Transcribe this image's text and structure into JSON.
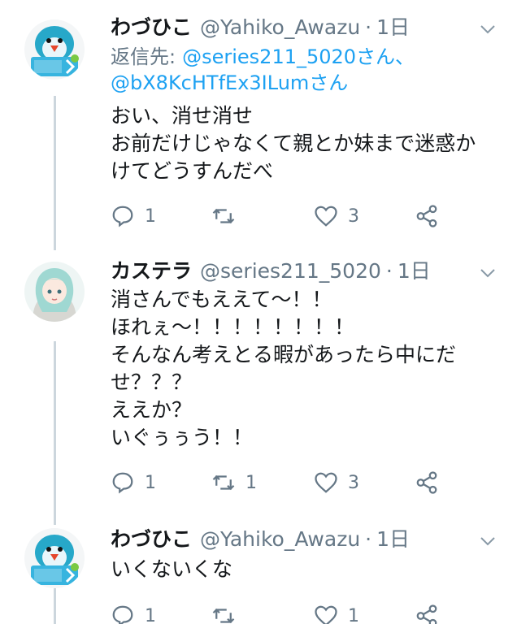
{
  "tweets": [
    {
      "name": "わづひこ",
      "handle": "@Yahiko_Awazu",
      "sep": "·",
      "time": "1日",
      "reply_label": "返信先:",
      "reply_to_1": "@series211_5020さん、",
      "reply_to_2": "@bX8KcHTfEx3ILumさん",
      "lines": [
        "おい、消せ消せ",
        "お前だけじゃなくて親とか妹まで迷惑か",
        "けてどうすんだべ"
      ],
      "replies": "1",
      "retweets": "",
      "likes": "3",
      "avatar_icon": "penguin-suica-icon"
    },
    {
      "name": "カステラ",
      "handle": "@series211_5020",
      "sep": "·",
      "time": "1日",
      "lines": [
        "消さんでもええて〜！！",
        "ほれぇ〜！！！！！！！！",
        "そんなん考えとる暇があったら中にだ",
        "せ？？？",
        "ええか？",
        "いぐぅぅう！！"
      ],
      "replies": "1",
      "retweets": "1",
      "likes": "3",
      "avatar_icon": "anime-girl-avatar-icon"
    },
    {
      "name": "わづひこ",
      "handle": "@Yahiko_Awazu",
      "sep": "·",
      "time": "1日",
      "lines": [
        "いくないくな"
      ],
      "replies": "1",
      "retweets": "",
      "likes": "1",
      "avatar_icon": "penguin-suica-icon"
    }
  ],
  "colors": {
    "text": "#14171a",
    "secondary": "#657786",
    "link": "#1da1f2",
    "thread_line": "#ccd6dd"
  }
}
